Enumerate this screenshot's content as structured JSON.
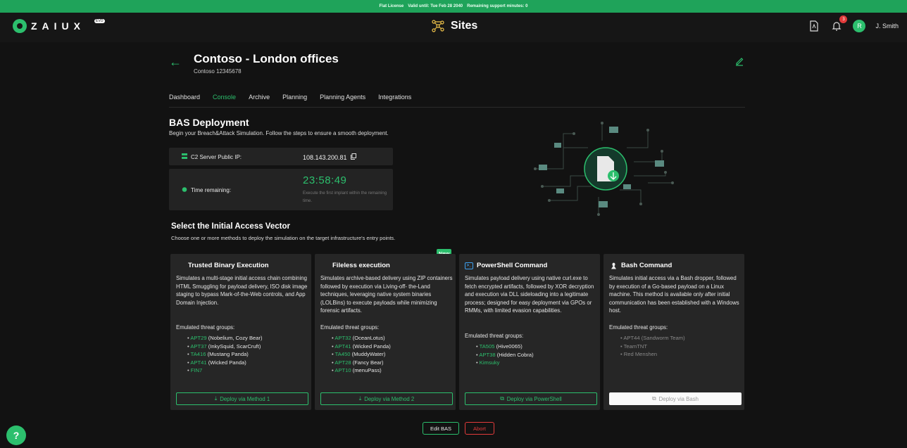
{
  "license_bar": {
    "type": "Flat License",
    "valid_until": "Valid until: Tue Feb 28 2040",
    "support": "Remaining support minutes: 0"
  },
  "header": {
    "logo_text": "ZAIUX",
    "logo_badge": "EVO",
    "title": "Sites",
    "notification_count": "3",
    "avatar_initial": "R",
    "user_name": "J. Smith"
  },
  "site": {
    "title": "Contoso - London offices",
    "subtitle": "Contoso  12345678"
  },
  "tabs": [
    {
      "label": "Dashboard",
      "active": false
    },
    {
      "label": "Console",
      "active": true
    },
    {
      "label": "Archive",
      "active": false
    },
    {
      "label": "Planning",
      "active": false
    },
    {
      "label": "Planning Agents",
      "active": false
    },
    {
      "label": "Integrations",
      "active": false
    }
  ],
  "bas": {
    "title": "BAS Deployment",
    "subtitle": "Begin your Breach&Attack Simulation. Follow the steps to ensure a smooth deployment.",
    "ip_label": "C2 Server Public IP:",
    "ip_value": "108.143.200.81",
    "time_label": "Time remaining:",
    "time_value": "23:58:49",
    "time_hint": "Execute the first implant within the remaining time."
  },
  "vector": {
    "title": "Select the Initial Access Vector",
    "subtitle": "Choose one or more methods to deploy the simulation on the target infrastructure's entry points."
  },
  "cards": [
    {
      "title": "Trusted Binary Execution",
      "icon": "windows-icon",
      "description": "Simulates a multi-stage initial access chain combining HTML Smuggling for payload delivery, ISO disk image staging to bypass Mark-of-the-Web controls, and App Domain Injection.",
      "groups_label": "Emulated threat groups:",
      "groups": [
        {
          "code": "APT29",
          "name": "(Nobelium, Cozy Bear)"
        },
        {
          "code": "APT37",
          "name": "(InkySquid, ScarCruft)"
        },
        {
          "code": "TA416",
          "name": "(Mustang Panda)"
        },
        {
          "code": "APT41",
          "name": "(Wicked Panda)"
        },
        {
          "code": "FIN7",
          "name": ""
        }
      ],
      "button": "Deploy via Method 1"
    },
    {
      "title": "Fileless execution",
      "icon": "windows-icon",
      "badge": "New",
      "description": "Simulates archive-based delivery using ZIP containers followed by execution via Living-off- the-Land techniques, leveraging native system binaries (LOLBins) to execute payloads while minimizing forensic artifacts.",
      "groups_label": "Emulated threat groups:",
      "groups": [
        {
          "code": "APT32",
          "name": "(OceanLotus)"
        },
        {
          "code": "APT41",
          "name": "(Wicked Panda)"
        },
        {
          "code": "TA450",
          "name": "(MuddyWater)"
        },
        {
          "code": "APT28",
          "name": "(Fancy Bear)"
        },
        {
          "code": "APT10",
          "name": "(menuPass)"
        }
      ],
      "button": "Deploy via Method 2"
    },
    {
      "title": "PowerShell Command",
      "icon": "powershell-icon",
      "description": "Simulates payload delivery using native curl.exe to fetch encrypted artifacts, followed by XOR decryption and execution via DLL sideloading into a legitimate process; designed for easy deployment via GPOs or RMMs, with limited evasion capabilities.",
      "groups_label": "Emulated threat groups:",
      "groups": [
        {
          "code": "TA505",
          "name": "(Hive0065)"
        },
        {
          "code": "APT38",
          "name": "(Hidden Cobra)"
        },
        {
          "code": "Kimsuky",
          "name": ""
        }
      ],
      "button": "Deploy via PowerShell"
    },
    {
      "title": "Bash Command",
      "icon": "linux-icon",
      "description": "Simulates initial access via a Bash dropper, followed by execution of a Go-based payload on a Linux machine. This method is available only after initial communication has been established with a Windows host.",
      "groups_label": "Emulated threat groups:",
      "groups": [
        {
          "code": "APT44",
          "name": "(Sandworm Team)"
        },
        {
          "code": "TeamTNT",
          "name": ""
        },
        {
          "code": "Red Menshen",
          "name": ""
        }
      ],
      "button": "Deploy via Bash"
    }
  ],
  "footer": {
    "edit_label": "Edit BAS",
    "abort_label": "Abort",
    "help_label": "?"
  },
  "colors": {
    "accent": "#2cbf6d",
    "danger": "#e23b3b",
    "background": "#121212",
    "card": "#262626"
  }
}
